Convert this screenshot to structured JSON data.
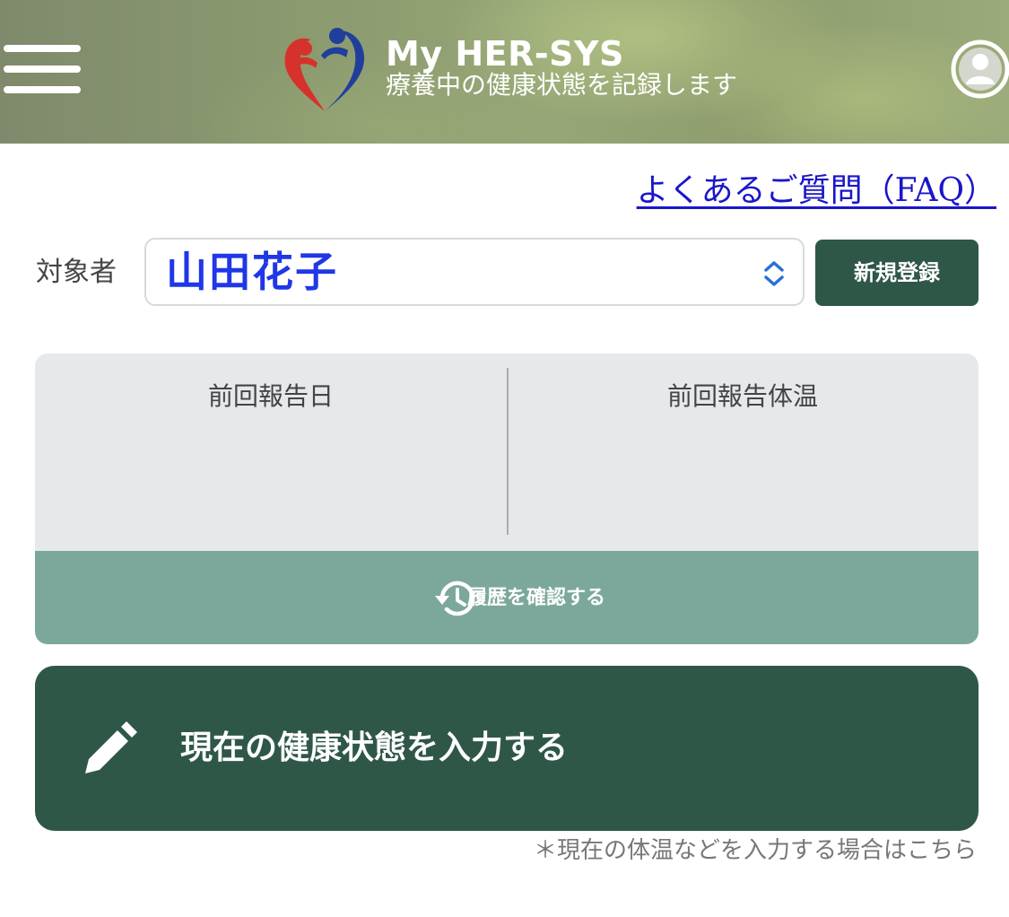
{
  "header": {
    "menu_icon": "hamburger-menu-icon",
    "logo_icon": "her-sys-heart-logo",
    "title": "My HER-SYS",
    "subtitle": "療養中の健康状態を記録します",
    "account_icon": "user-account-icon"
  },
  "faq": {
    "label": "よくあるご質問（FAQ）"
  },
  "target": {
    "label": "対象者",
    "selected_value": "山田花子",
    "select_icon": "chevron-up-down-icon",
    "new_register_label": "新規登録"
  },
  "report": {
    "last_report_date_label": "前回報告日",
    "last_report_date_value": "",
    "last_report_temp_label": "前回報告体温",
    "last_report_temp_value": "",
    "history_icon": "history-icon",
    "history_label": "履歴を確認する"
  },
  "input_cta": {
    "icon": "pencil-icon",
    "label": "現在の健康状態を入力する",
    "note": "＊現在の体温などを入力する場合はこちら"
  },
  "colors": {
    "primary_dark_green": "#2f5748",
    "history_green": "#7ca89b",
    "card_gray": "#e6e9eb",
    "link_blue": "#1a16c9",
    "selected_name_blue": "#1f37e6",
    "logo_red": "#d6322b",
    "logo_blue": "#1f3f9a"
  }
}
